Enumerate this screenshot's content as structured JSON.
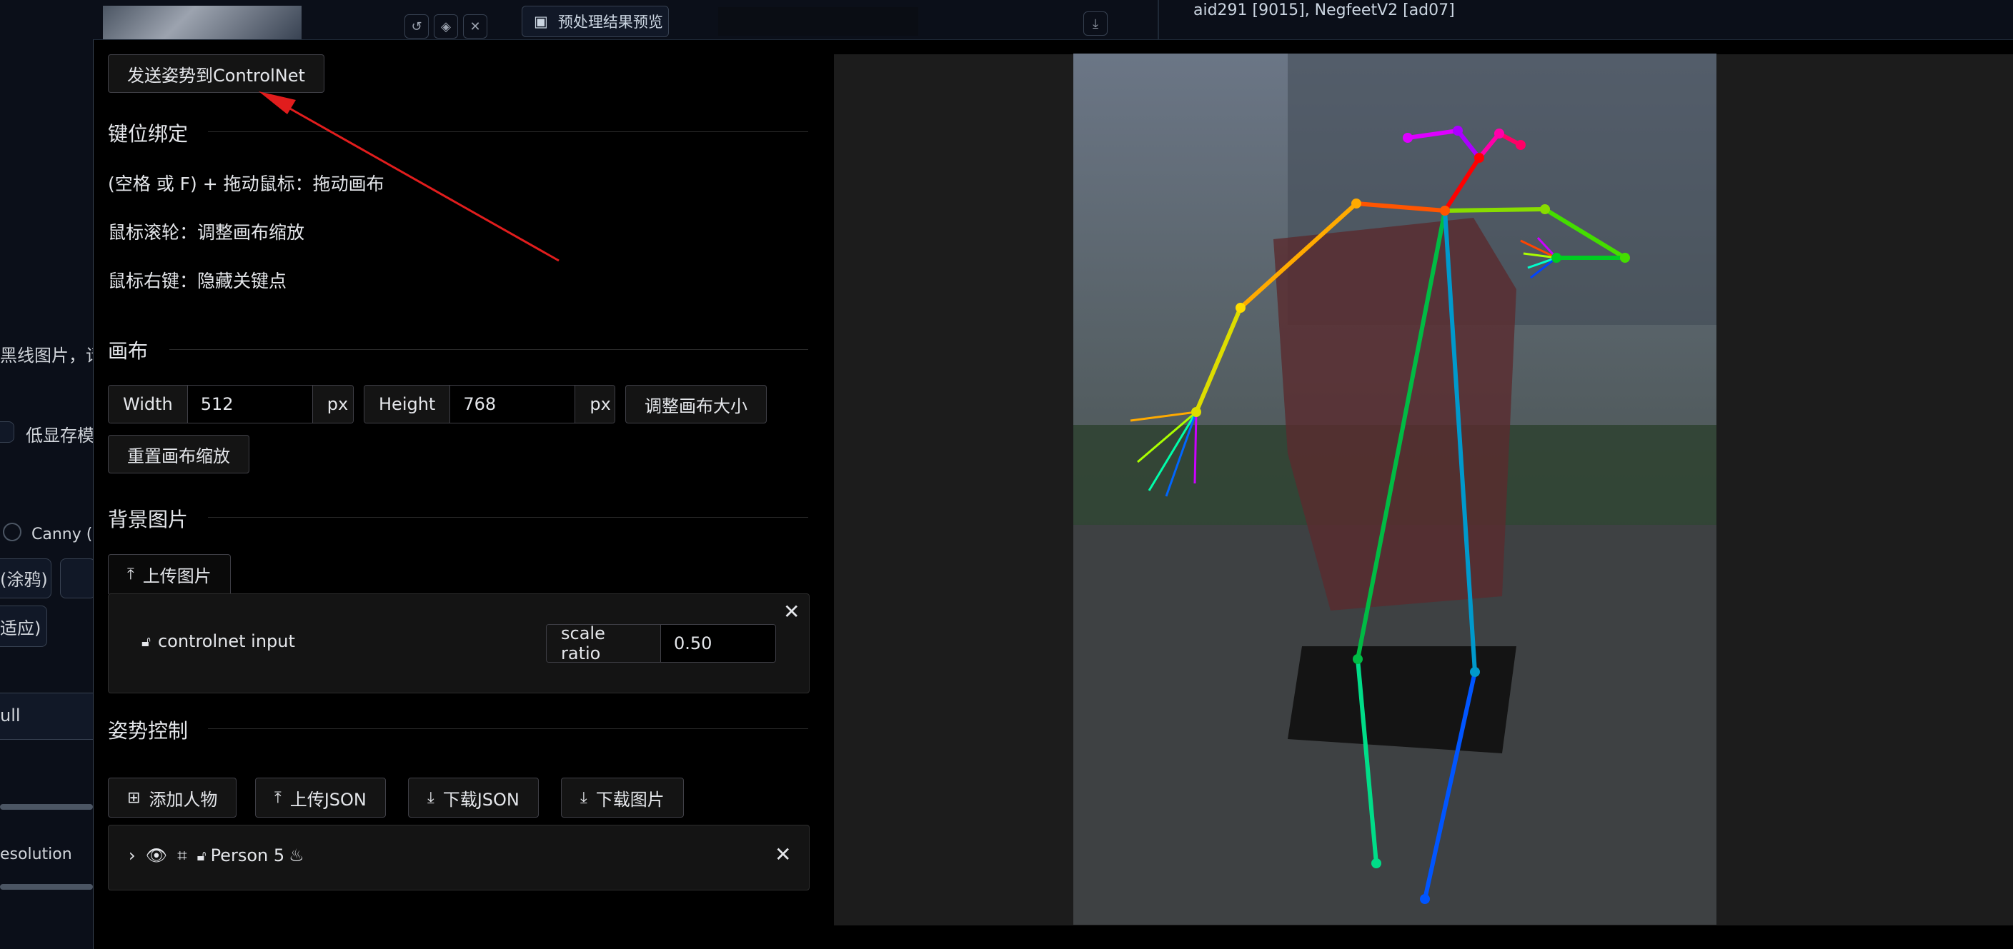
{
  "background": {
    "preview_tab_label": "预处理结果预览",
    "model_info": "aid291 [9015], NegfeetV2 [ad07]",
    "fragments": {
      "hint": "黑线图片，请",
      "lowvram": "低显存模",
      "canny": "Canny (硬",
      "scribble": "(涂鸦)",
      "adaptive": "适应)",
      "null": "ull",
      "resolution": "esolution"
    }
  },
  "toolbar": {
    "send_pose_label": "发送姿势到ControlNet"
  },
  "keybindings": {
    "title": "键位绑定",
    "lines": [
      "(空格 或 F) + 拖动鼠标：拖动画布",
      "鼠标滚轮：调整画布缩放",
      "鼠标右键：隐藏关键点"
    ]
  },
  "canvas": {
    "title": "画布",
    "width_label": "Width",
    "width_value": "512",
    "height_label": "Height",
    "height_value": "768",
    "unit": "px",
    "resize_button": "调整画布大小",
    "reset_zoom_button": "重置画布缩放"
  },
  "background_image": {
    "title": "背景图片",
    "upload_button": "上传图片",
    "layer_name": "controlnet input",
    "scale_label": "scale ratio",
    "scale_value": "0.50"
  },
  "pose_control": {
    "title": "姿势控制",
    "add_person": "添加人物",
    "upload_json": "上传JSON",
    "download_json": "下载JSON",
    "download_image": "下载图片",
    "person_label": "Person 5"
  },
  "colors": {
    "annotation_arrow": "#e11d1d",
    "canvas_bg": "#1c1c1c",
    "modal_bg": "#000000"
  }
}
